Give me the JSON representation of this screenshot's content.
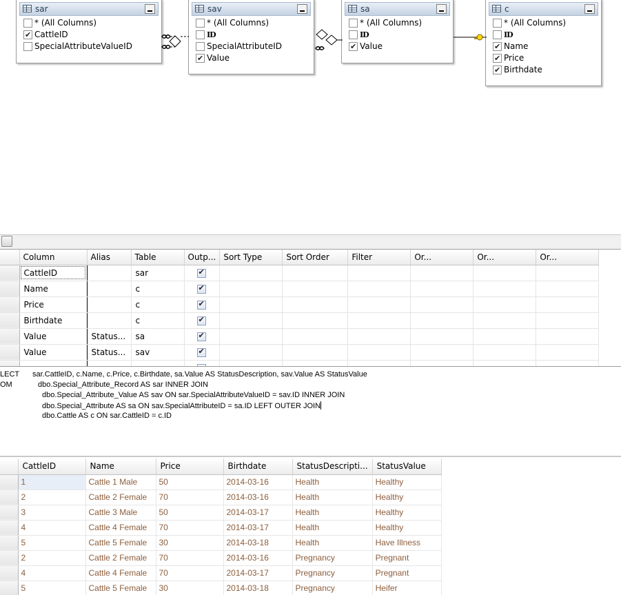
{
  "diagram": {
    "tables": [
      {
        "id": "sar",
        "title": "sar",
        "columns": [
          {
            "label": "* (All Columns)",
            "checked": false,
            "pk": false
          },
          {
            "label": "CattleID",
            "checked": true,
            "pk": false
          },
          {
            "label": "SpecialAttributeValueID",
            "checked": false,
            "pk": false
          }
        ]
      },
      {
        "id": "sav",
        "title": "sav",
        "columns": [
          {
            "label": "* (All Columns)",
            "checked": false,
            "pk": false
          },
          {
            "label": "ID",
            "checked": false,
            "pk": true
          },
          {
            "label": "SpecialAttributeID",
            "checked": false,
            "pk": false
          },
          {
            "label": "Value",
            "checked": true,
            "pk": false
          }
        ]
      },
      {
        "id": "sa",
        "title": "sa",
        "columns": [
          {
            "label": "* (All Columns)",
            "checked": false,
            "pk": false
          },
          {
            "label": "ID",
            "checked": false,
            "pk": true
          },
          {
            "label": "Value",
            "checked": true,
            "pk": false
          }
        ]
      },
      {
        "id": "c",
        "title": "c",
        "columns": [
          {
            "label": "* (All Columns)",
            "checked": false,
            "pk": false
          },
          {
            "label": "ID",
            "checked": false,
            "pk": true
          },
          {
            "label": "Name",
            "checked": true,
            "pk": false
          },
          {
            "label": "Price",
            "checked": true,
            "pk": false
          },
          {
            "label": "Birthdate",
            "checked": true,
            "pk": false
          }
        ]
      }
    ]
  },
  "criteria": {
    "headers": [
      "Column",
      "Alias",
      "Table",
      "Outp...",
      "Sort Type",
      "Sort Order",
      "Filter",
      "Or...",
      "Or...",
      "Or..."
    ],
    "rows": [
      {
        "column": "CattleID",
        "alias": "",
        "table": "sar",
        "output": true
      },
      {
        "column": "Name",
        "alias": "",
        "table": "c",
        "output": true
      },
      {
        "column": "Price",
        "alias": "",
        "table": "c",
        "output": true
      },
      {
        "column": "Birthdate",
        "alias": "",
        "table": "c",
        "output": true
      },
      {
        "column": "Value",
        "alias": "Status...",
        "table": "sa",
        "output": true
      },
      {
        "column": "Value",
        "alias": "Status...",
        "table": "sav",
        "output": true
      }
    ]
  },
  "sql": {
    "lines": [
      {
        "keyword": "LECT",
        "text": "sar.CattleID, c.Name, c.Price, c.Birthdate, sa.Value AS StatusDescription, sav.Value AS StatusValue"
      },
      {
        "keyword": "OM",
        "text": "dbo.Special_Attribute_Record AS sar INNER JOIN"
      },
      {
        "keyword": "",
        "text": "dbo.Special_Attribute_Value AS sav ON sar.SpecialAttributeValueID = sav.ID INNER JOIN"
      },
      {
        "keyword": "",
        "text": "dbo.Special_Attribute AS sa ON sav.SpecialAttributeID = sa.ID LEFT OUTER JOIN"
      },
      {
        "keyword": "",
        "text": "dbo.Cattle AS c ON sar.CattleID = c.ID"
      }
    ]
  },
  "results": {
    "headers": [
      "CattleID",
      "Name",
      "Price",
      "Birthdate",
      "StatusDescripti...",
      "StatusValue"
    ],
    "rows": [
      [
        "1",
        "Cattle 1 Male",
        "50",
        "2014-03-16",
        "Health",
        "Healthy"
      ],
      [
        "2",
        "Cattle 2 Female",
        "70",
        "2014-03-16",
        "Health",
        "Healthy"
      ],
      [
        "3",
        "Cattle 3 Male",
        "50",
        "2014-03-17",
        "Health",
        "Healthy"
      ],
      [
        "4",
        "Cattle 4 Female",
        "70",
        "2014-03-17",
        "Health",
        "Healthy"
      ],
      [
        "5",
        "Cattle 5 Female",
        "30",
        "2014-03-18",
        "Health",
        "Have Illness"
      ],
      [
        "2",
        "Cattle 2 Female",
        "70",
        "2014-03-16",
        "Pregnancy",
        "Pregnant"
      ],
      [
        "4",
        "Cattle 4 Female",
        "70",
        "2014-03-17",
        "Pregnancy",
        "Pregnant"
      ],
      [
        "5",
        "Cattle 5 Female",
        "30",
        "2014-03-18",
        "Pregnancy",
        "Heifer"
      ]
    ]
  },
  "colors": {
    "result_text": "#8c5e3c",
    "title_bar": "#c4d2e3",
    "key_icon": "#d4b000"
  }
}
